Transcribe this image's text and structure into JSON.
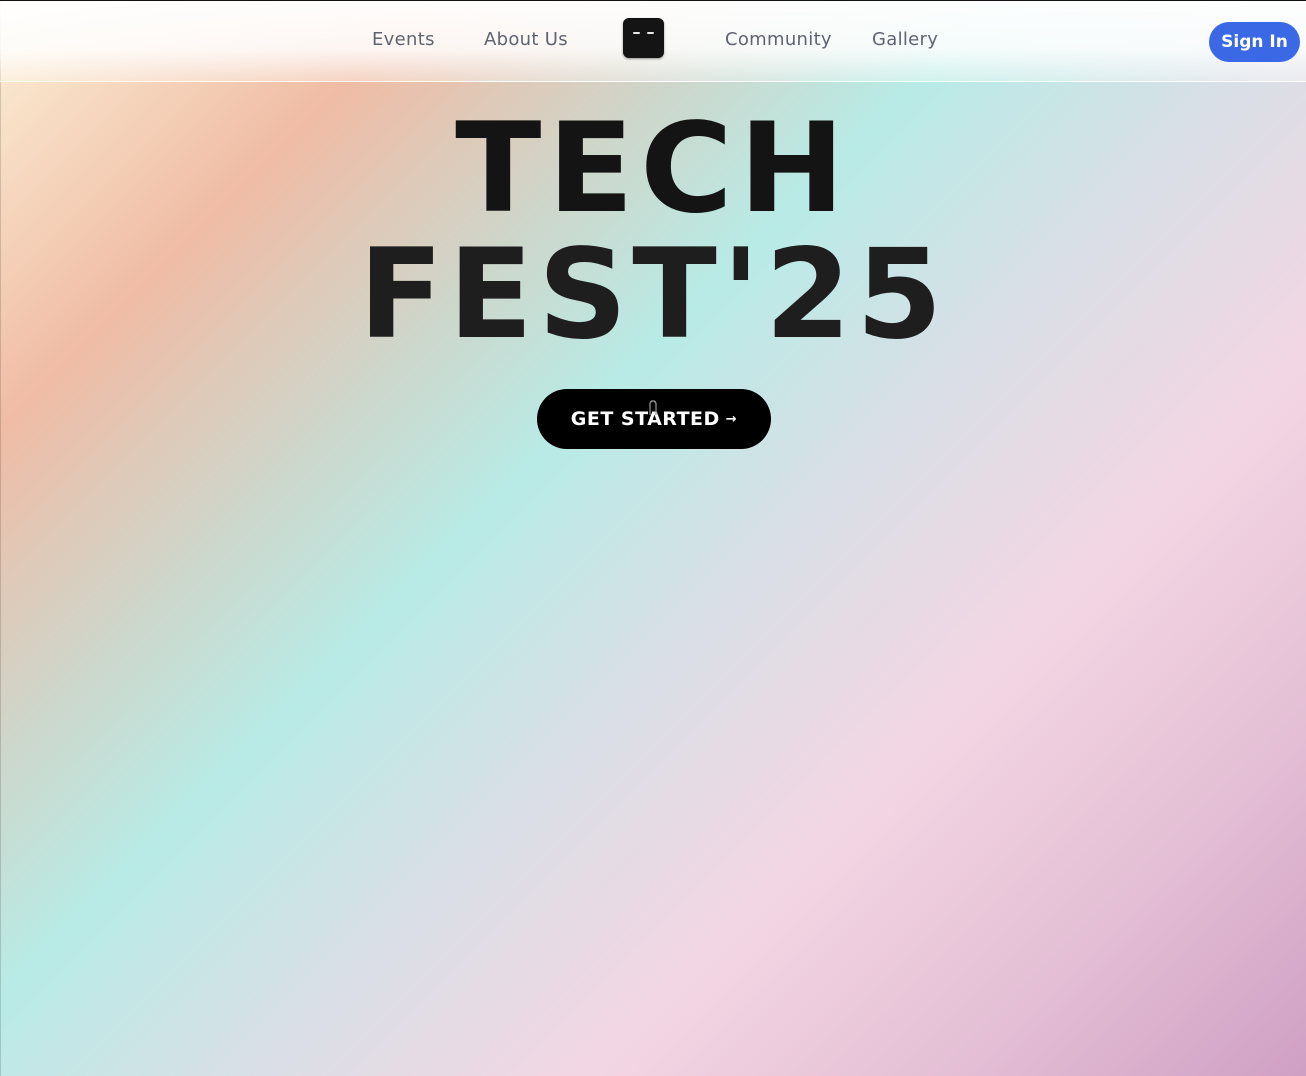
{
  "nav": {
    "links": [
      "Events",
      "About Us",
      "Community",
      "Gallery"
    ],
    "logo_icon": "robot-face-icon",
    "signin_label": "Sign In"
  },
  "hero": {
    "title_line1": "TECH",
    "title_line2": "FEST'25",
    "cta_label": "GET STARTED",
    "cta_arrow": "→"
  },
  "colors": {
    "accent_blue": "#3b69e6",
    "cta_bg": "#000000",
    "logo_bg": "#141414",
    "gradient": [
      "#fbf0d6",
      "#f0bca5",
      "#b8ebe6",
      "#f3d6e3",
      "#cf9fc4"
    ]
  }
}
